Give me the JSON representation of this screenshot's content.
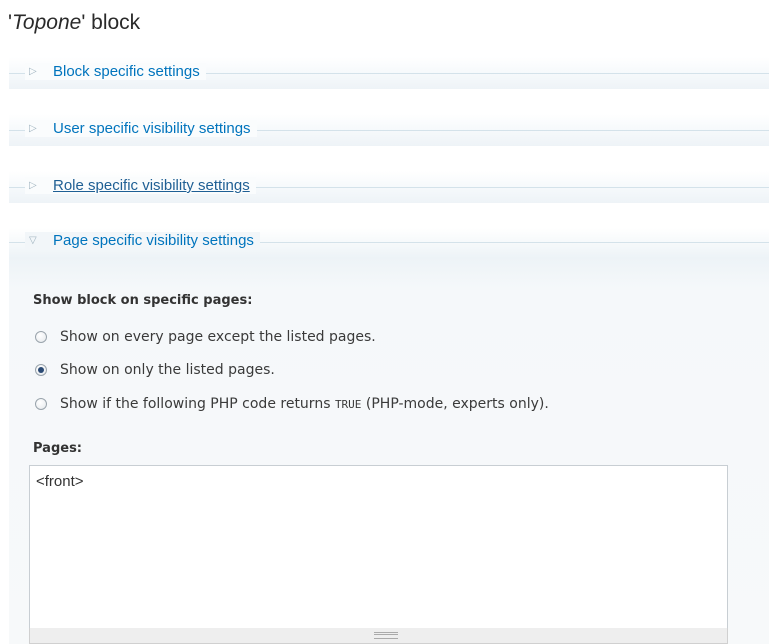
{
  "page": {
    "title_quoted": "Topone",
    "title_rest": " block"
  },
  "fieldsets": [
    {
      "label": "Block specific settings",
      "state": "collapsed"
    },
    {
      "label": "User specific visibility settings",
      "state": "collapsed"
    },
    {
      "label": "Role specific visibility settings",
      "state": "collapsed"
    },
    {
      "label": "Page specific visibility settings",
      "state": "expanded"
    }
  ],
  "icons": {
    "collapsed": "triangle-right-icon",
    "expanded": "triangle-down-icon"
  },
  "page_visibility": {
    "heading": "Show block on specific pages:",
    "options": [
      {
        "label": "Show on every page except the listed pages.",
        "checked": false
      },
      {
        "label": "Show on only the listed pages.",
        "checked": true
      },
      {
        "label_before": "Show if the following PHP code returns ",
        "code": "TRUE",
        "label_after": " (PHP-mode, experts only).",
        "checked": false
      }
    ],
    "pages_label": "Pages:",
    "pages_value": "<front>"
  },
  "colors": {
    "link": "#0074bd",
    "rule": "#d4e2ea"
  }
}
